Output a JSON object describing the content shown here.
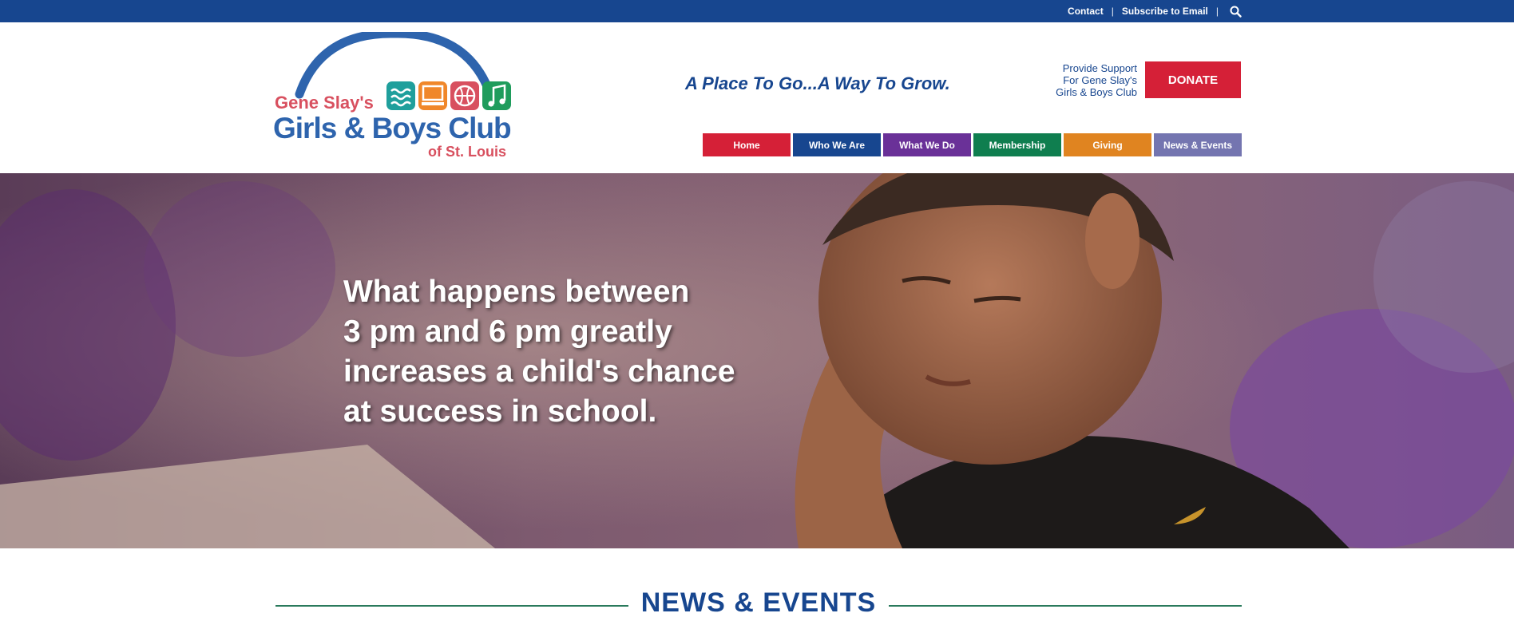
{
  "topbar": {
    "contact": "Contact",
    "subscribe": "Subscribe to Email",
    "separator": "|"
  },
  "logo": {
    "line1": "Gene Slay's",
    "line2": "Girls & Boys Club",
    "line3": "of St. Louis"
  },
  "tagline": "A Place To Go...A Way To Grow.",
  "support": {
    "line1": "Provide Support",
    "line2": "For Gene Slay's",
    "line3": "Girls & Boys Club"
  },
  "donate_label": "DONATE",
  "nav": [
    {
      "label": "Home",
      "color": "#d52037"
    },
    {
      "label": "Who We Are",
      "color": "#17468f"
    },
    {
      "label": "What We Do",
      "color": "#6a3198"
    },
    {
      "label": "Membership",
      "color": "#0f7e4f"
    },
    {
      "label": "Giving",
      "color": "#e08420"
    },
    {
      "label": "News & Events",
      "color": "#7475b0"
    }
  ],
  "hero": {
    "lines": [
      "What happens between",
      "3 pm and 6 pm greatly",
      "increases a child's chance",
      "at success in school."
    ]
  },
  "news_heading": "NEWS & EVENTS",
  "colors": {
    "brand_blue": "#17468f",
    "donate_red": "#d52037",
    "divider_green": "#2a7a5c"
  }
}
